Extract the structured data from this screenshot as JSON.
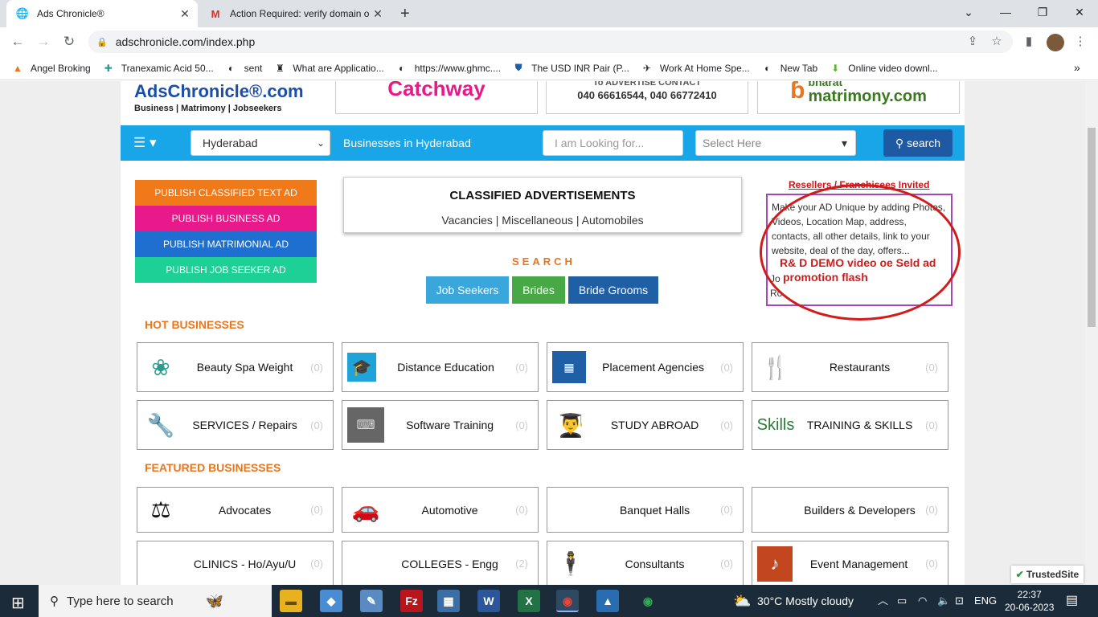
{
  "browser": {
    "tabs": [
      {
        "title": "Ads Chronicle®",
        "active": true
      },
      {
        "title": "Action Required: verify domain o",
        "active": false
      }
    ],
    "url": "adschronicle.com/index.php",
    "bookmarks": [
      "Angel Broking",
      "Tranexamic Acid 50...",
      "sent",
      "What are Applicatio...",
      "https://www.ghmc....",
      "The USD INR Pair (P...",
      "Work At Home Spe...",
      "New Tab",
      "Online video downl..."
    ]
  },
  "site": {
    "logo": "AdsChronicle®.com",
    "tagline": "Business | Matrimony | Jobseekers",
    "banners": {
      "catchway": "Catchway",
      "advertise": "To ADVERTISE CONTACT",
      "phones": "040 66616544, 040 66772410",
      "bharat": "bharat",
      "matrimony": "matrimony.com"
    },
    "city": "Hyderabad",
    "businesses_in": "Businesses in Hyderabad",
    "looking_placeholder": "I am Looking for...",
    "select_here": "Select Here",
    "search_label": "search",
    "publish_buttons": [
      {
        "label": "PUBLISH CLASSIFIED TEXT AD",
        "color": "#f07a1a"
      },
      {
        "label": "PUBLISH BUSINESS AD",
        "color": "#e8198b"
      },
      {
        "label": "PUBLISH MATRIMONIAL AD",
        "color": "#1f6fd1"
      },
      {
        "label": "PUBLISH JOB SEEKER AD",
        "color": "#1dd196"
      }
    ],
    "classified_title": "CLASSIFIED ADVERTISEMENTS",
    "classified_links": "Vacancies | Miscellaneous | Automobiles",
    "search_heading": "SEARCH",
    "pills": [
      {
        "label": "Job Seekers",
        "color": "#3aa7dc"
      },
      {
        "label": "Brides",
        "color": "#47a846"
      },
      {
        "label": "Bride Grooms",
        "color": "#1f5fa6"
      }
    ],
    "resellers": "Resellers / Franchisees Invited",
    "ad_text": "Make your AD Unique by adding Photos, Videos, Location Map, address, contacts, all other details, link to your website, deal of the day, offers...",
    "demo_line1": "R& D DEMO video oe Seld ad",
    "demo_line2": "promotion flash",
    "jo_text": "Jo",
    "ro_text": "Ro",
    "hot_heading": "HOT BUSINESSES",
    "featured_heading": "FEATURED BUSINESSES",
    "hot": [
      {
        "name": "Beauty Spa Weight",
        "count": "(0)",
        "icon": "lotus-icon"
      },
      {
        "name": "Distance Education",
        "count": "(0)",
        "icon": "graduation-cap-icon"
      },
      {
        "name": "Placement Agencies",
        "count": "(0)",
        "icon": "placement-icon"
      },
      {
        "name": "Restaurants",
        "count": "(0)",
        "icon": "fork-knife-icon"
      },
      {
        "name": "SERVICES / Repairs",
        "count": "(0)",
        "icon": "tools-icon"
      },
      {
        "name": "Software Training",
        "count": "(0)",
        "icon": "keyboard-icon"
      },
      {
        "name": "STUDY ABROAD",
        "count": "(0)",
        "icon": "graduate-icon"
      },
      {
        "name": "TRAINING & SKILLS",
        "count": "(0)",
        "icon": "skills-icon"
      }
    ],
    "featured": [
      {
        "name": "Advocates",
        "count": "(0)",
        "icon": "scales-icon"
      },
      {
        "name": "Automotive",
        "count": "(0)",
        "icon": "car-icon"
      },
      {
        "name": "Banquet Halls",
        "count": "(0)",
        "icon": ""
      },
      {
        "name": "Builders & Developers",
        "count": "(0)",
        "icon": ""
      },
      {
        "name": "CLINICS - Ho/Ayu/U",
        "count": "(0)",
        "icon": ""
      },
      {
        "name": "COLLEGES - Engg",
        "count": "(2)",
        "icon": ""
      },
      {
        "name": "Consultants",
        "count": "(0)",
        "icon": "businessman-icon"
      },
      {
        "name": "Event Management",
        "count": "(0)",
        "icon": "event-icon"
      }
    ],
    "skills_logo": "Skills",
    "trusted": "TrustedSite"
  },
  "taskbar": {
    "search_placeholder": "Type here to search",
    "weather": "30°C  Mostly cloudy",
    "lang": "ENG",
    "time": "22:37",
    "date": "20-06-2023"
  }
}
